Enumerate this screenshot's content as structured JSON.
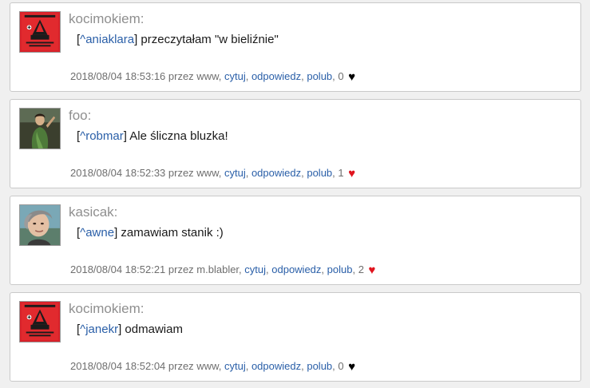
{
  "posts": [
    {
      "username": "kocimokiem:",
      "avatar": "red-poster-avatar",
      "mention": "^aniaklara",
      "text": " przeczytałam \"w bieliźnie\"",
      "timestamp": "2018/08/04 18:53:16",
      "via_prefix": " przez ",
      "via": "www",
      "actions": {
        "quote": "cytuj",
        "reply": "odpowiedz",
        "like": "polub"
      },
      "likes": "0",
      "heart_color": "#000000"
    },
    {
      "username": "foo:",
      "avatar": "painting-portrait-avatar",
      "mention": "^robmar",
      "text": " Ale śliczna bluzka!",
      "timestamp": "2018/08/04 18:52:33",
      "via_prefix": " przez ",
      "via": "www",
      "actions": {
        "quote": "cytuj",
        "reply": "odpowiedz",
        "like": "polub"
      },
      "likes": "1",
      "heart_color": "#e0141e"
    },
    {
      "username": "kasicak:",
      "avatar": "photo-portrait-avatar",
      "mention": "^awne",
      "text": " zamawiam stanik :)",
      "timestamp": "2018/08/04 18:52:21",
      "via_prefix": " przez ",
      "via": "m.blabler",
      "actions": {
        "quote": "cytuj",
        "reply": "odpowiedz",
        "like": "polub"
      },
      "likes": "2",
      "heart_color": "#e0141e"
    },
    {
      "username": "kocimokiem:",
      "avatar": "red-poster-avatar",
      "mention": "^janekr",
      "text": " odmawiam",
      "timestamp": "2018/08/04 18:52:04",
      "via_prefix": " przez ",
      "via": "www",
      "actions": {
        "quote": "cytuj",
        "reply": "odpowiedz",
        "like": "polub"
      },
      "likes": "0",
      "heart_color": "#000000"
    }
  ],
  "symbols": {
    "heart": "♥",
    "comma": ", ",
    "open_bracket": "[",
    "close_bracket": "]"
  }
}
